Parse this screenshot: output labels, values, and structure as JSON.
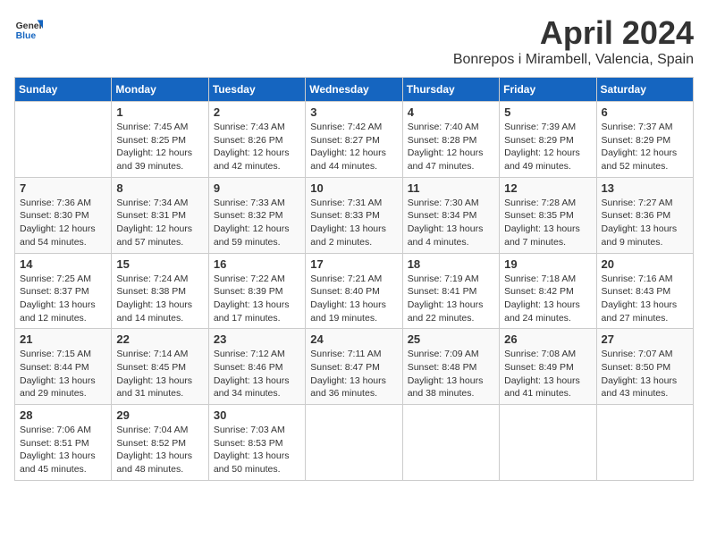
{
  "header": {
    "logo_general": "General",
    "logo_blue": "Blue",
    "month_title": "April 2024",
    "subtitle": "Bonrepos i Mirambell, Valencia, Spain"
  },
  "columns": [
    "Sunday",
    "Monday",
    "Tuesday",
    "Wednesday",
    "Thursday",
    "Friday",
    "Saturday"
  ],
  "weeks": [
    [
      {
        "day": "",
        "info": ""
      },
      {
        "day": "1",
        "info": "Sunrise: 7:45 AM\nSunset: 8:25 PM\nDaylight: 12 hours\nand 39 minutes."
      },
      {
        "day": "2",
        "info": "Sunrise: 7:43 AM\nSunset: 8:26 PM\nDaylight: 12 hours\nand 42 minutes."
      },
      {
        "day": "3",
        "info": "Sunrise: 7:42 AM\nSunset: 8:27 PM\nDaylight: 12 hours\nand 44 minutes."
      },
      {
        "day": "4",
        "info": "Sunrise: 7:40 AM\nSunset: 8:28 PM\nDaylight: 12 hours\nand 47 minutes."
      },
      {
        "day": "5",
        "info": "Sunrise: 7:39 AM\nSunset: 8:29 PM\nDaylight: 12 hours\nand 49 minutes."
      },
      {
        "day": "6",
        "info": "Sunrise: 7:37 AM\nSunset: 8:29 PM\nDaylight: 12 hours\nand 52 minutes."
      }
    ],
    [
      {
        "day": "7",
        "info": "Sunrise: 7:36 AM\nSunset: 8:30 PM\nDaylight: 12 hours\nand 54 minutes."
      },
      {
        "day": "8",
        "info": "Sunrise: 7:34 AM\nSunset: 8:31 PM\nDaylight: 12 hours\nand 57 minutes."
      },
      {
        "day": "9",
        "info": "Sunrise: 7:33 AM\nSunset: 8:32 PM\nDaylight: 12 hours\nand 59 minutes."
      },
      {
        "day": "10",
        "info": "Sunrise: 7:31 AM\nSunset: 8:33 PM\nDaylight: 13 hours\nand 2 minutes."
      },
      {
        "day": "11",
        "info": "Sunrise: 7:30 AM\nSunset: 8:34 PM\nDaylight: 13 hours\nand 4 minutes."
      },
      {
        "day": "12",
        "info": "Sunrise: 7:28 AM\nSunset: 8:35 PM\nDaylight: 13 hours\nand 7 minutes."
      },
      {
        "day": "13",
        "info": "Sunrise: 7:27 AM\nSunset: 8:36 PM\nDaylight: 13 hours\nand 9 minutes."
      }
    ],
    [
      {
        "day": "14",
        "info": "Sunrise: 7:25 AM\nSunset: 8:37 PM\nDaylight: 13 hours\nand 12 minutes."
      },
      {
        "day": "15",
        "info": "Sunrise: 7:24 AM\nSunset: 8:38 PM\nDaylight: 13 hours\nand 14 minutes."
      },
      {
        "day": "16",
        "info": "Sunrise: 7:22 AM\nSunset: 8:39 PM\nDaylight: 13 hours\nand 17 minutes."
      },
      {
        "day": "17",
        "info": "Sunrise: 7:21 AM\nSunset: 8:40 PM\nDaylight: 13 hours\nand 19 minutes."
      },
      {
        "day": "18",
        "info": "Sunrise: 7:19 AM\nSunset: 8:41 PM\nDaylight: 13 hours\nand 22 minutes."
      },
      {
        "day": "19",
        "info": "Sunrise: 7:18 AM\nSunset: 8:42 PM\nDaylight: 13 hours\nand 24 minutes."
      },
      {
        "day": "20",
        "info": "Sunrise: 7:16 AM\nSunset: 8:43 PM\nDaylight: 13 hours\nand 27 minutes."
      }
    ],
    [
      {
        "day": "21",
        "info": "Sunrise: 7:15 AM\nSunset: 8:44 PM\nDaylight: 13 hours\nand 29 minutes."
      },
      {
        "day": "22",
        "info": "Sunrise: 7:14 AM\nSunset: 8:45 PM\nDaylight: 13 hours\nand 31 minutes."
      },
      {
        "day": "23",
        "info": "Sunrise: 7:12 AM\nSunset: 8:46 PM\nDaylight: 13 hours\nand 34 minutes."
      },
      {
        "day": "24",
        "info": "Sunrise: 7:11 AM\nSunset: 8:47 PM\nDaylight: 13 hours\nand 36 minutes."
      },
      {
        "day": "25",
        "info": "Sunrise: 7:09 AM\nSunset: 8:48 PM\nDaylight: 13 hours\nand 38 minutes."
      },
      {
        "day": "26",
        "info": "Sunrise: 7:08 AM\nSunset: 8:49 PM\nDaylight: 13 hours\nand 41 minutes."
      },
      {
        "day": "27",
        "info": "Sunrise: 7:07 AM\nSunset: 8:50 PM\nDaylight: 13 hours\nand 43 minutes."
      }
    ],
    [
      {
        "day": "28",
        "info": "Sunrise: 7:06 AM\nSunset: 8:51 PM\nDaylight: 13 hours\nand 45 minutes."
      },
      {
        "day": "29",
        "info": "Sunrise: 7:04 AM\nSunset: 8:52 PM\nDaylight: 13 hours\nand 48 minutes."
      },
      {
        "day": "30",
        "info": "Sunrise: 7:03 AM\nSunset: 8:53 PM\nDaylight: 13 hours\nand 50 minutes."
      },
      {
        "day": "",
        "info": ""
      },
      {
        "day": "",
        "info": ""
      },
      {
        "day": "",
        "info": ""
      },
      {
        "day": "",
        "info": ""
      }
    ]
  ]
}
